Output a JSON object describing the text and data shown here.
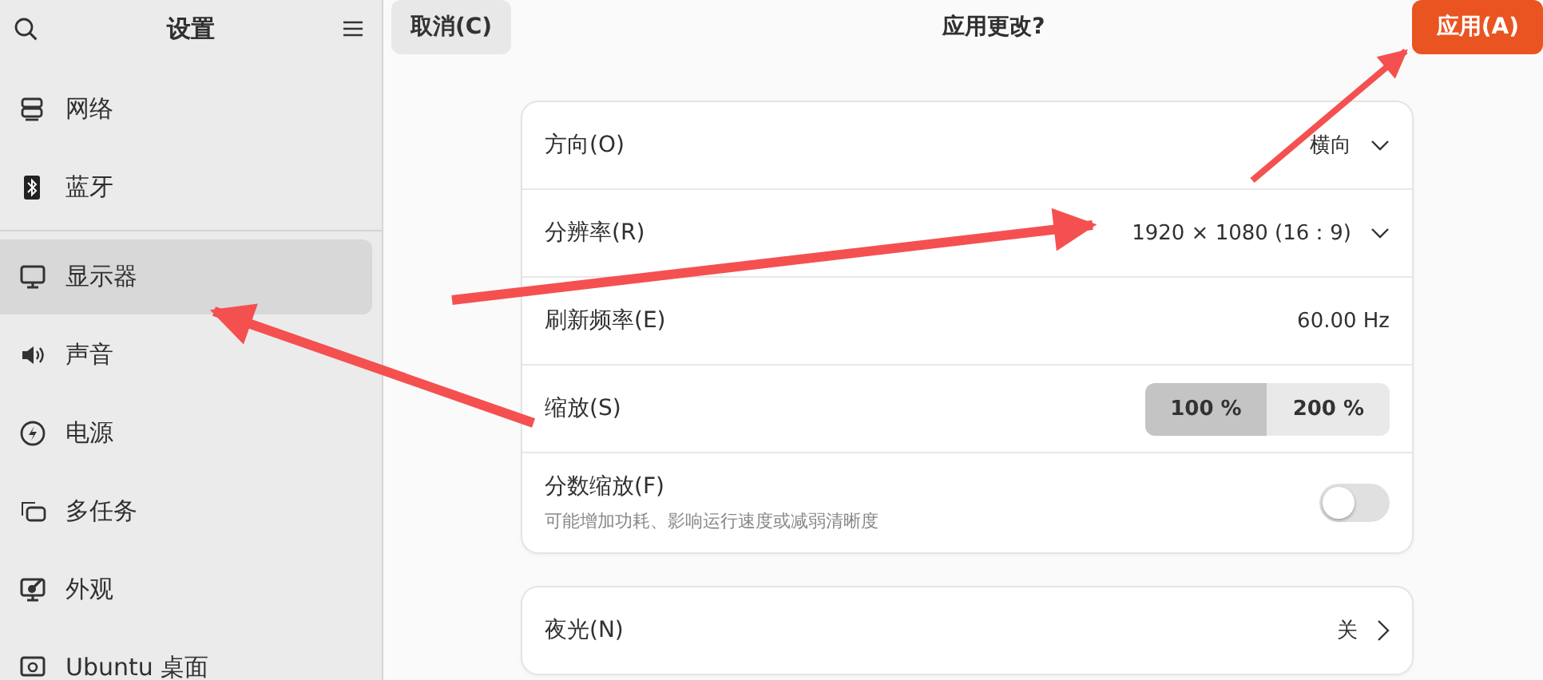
{
  "sidebar": {
    "title": "设置",
    "items": [
      {
        "label": "网络",
        "kind": "network",
        "selected": false,
        "separator_after": false
      },
      {
        "label": "蓝牙",
        "kind": "bluetooth",
        "selected": false,
        "separator_after": true
      },
      {
        "label": "显示器",
        "kind": "monitor",
        "selected": true,
        "separator_after": false
      },
      {
        "label": "声音",
        "kind": "speaker",
        "selected": false,
        "separator_after": false
      },
      {
        "label": "电源",
        "kind": "power",
        "selected": false,
        "separator_after": false
      },
      {
        "label": "多任务",
        "kind": "windows",
        "selected": false,
        "separator_after": false
      },
      {
        "label": "外观",
        "kind": "appearance",
        "selected": false,
        "separator_after": false
      },
      {
        "label": "Ubuntu 桌面",
        "kind": "desktop",
        "selected": false,
        "separator_after": false
      }
    ]
  },
  "header": {
    "cancel": "取消(C)",
    "title": "应用更改?",
    "apply": "应用(A)"
  },
  "cards": [
    {
      "rows": [
        {
          "kind": "dropdown",
          "label": "方向(O)",
          "value": "横向"
        },
        {
          "kind": "dropdown",
          "label": "分辨率(R)",
          "value": "1920 × 1080 (16：9)"
        },
        {
          "kind": "value",
          "label": "刷新频率(E)",
          "value": "60.00 Hz"
        },
        {
          "kind": "toggles",
          "label": "缩放(S)",
          "options": [
            {
              "label": "100 %",
              "selected": true
            },
            {
              "label": "200 %",
              "selected": false
            }
          ]
        },
        {
          "kind": "switch",
          "label": "分数缩放(F)",
          "subtitle": "可能增加功耗、影响运行速度或减弱清晰度",
          "on": false
        }
      ]
    },
    {
      "rows": [
        {
          "kind": "link",
          "label": "夜光(N)",
          "value": "关"
        }
      ]
    }
  ]
}
